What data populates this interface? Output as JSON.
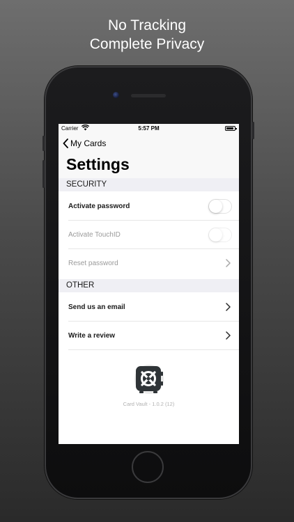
{
  "promo": {
    "line1": "No Tracking",
    "line2": "Complete Privacy"
  },
  "status_bar": {
    "carrier": "Carrier",
    "time": "5:57 PM"
  },
  "nav": {
    "back_label": "My Cards",
    "title": "Settings"
  },
  "sections": {
    "security": {
      "header": "SECURITY",
      "activate_password": {
        "label": "Activate password",
        "on": false
      },
      "activate_touchid": {
        "label": "Activate TouchID",
        "on": false
      },
      "reset_password": {
        "label": "Reset password"
      }
    },
    "other": {
      "header": "OTHER",
      "send_email": {
        "label": "Send us an email"
      },
      "write_review": {
        "label": "Write a review"
      }
    }
  },
  "footer": {
    "version": "Card Vault - 1.0.2 (12)"
  },
  "colors": {
    "accent": "#000000",
    "section_bg": "#efeff4",
    "dim_text": "#9a9a9a"
  },
  "icons": [
    "wifi-icon",
    "battery-icon",
    "chevron-left-icon",
    "chevron-right-icon",
    "vault-logo-icon"
  ]
}
